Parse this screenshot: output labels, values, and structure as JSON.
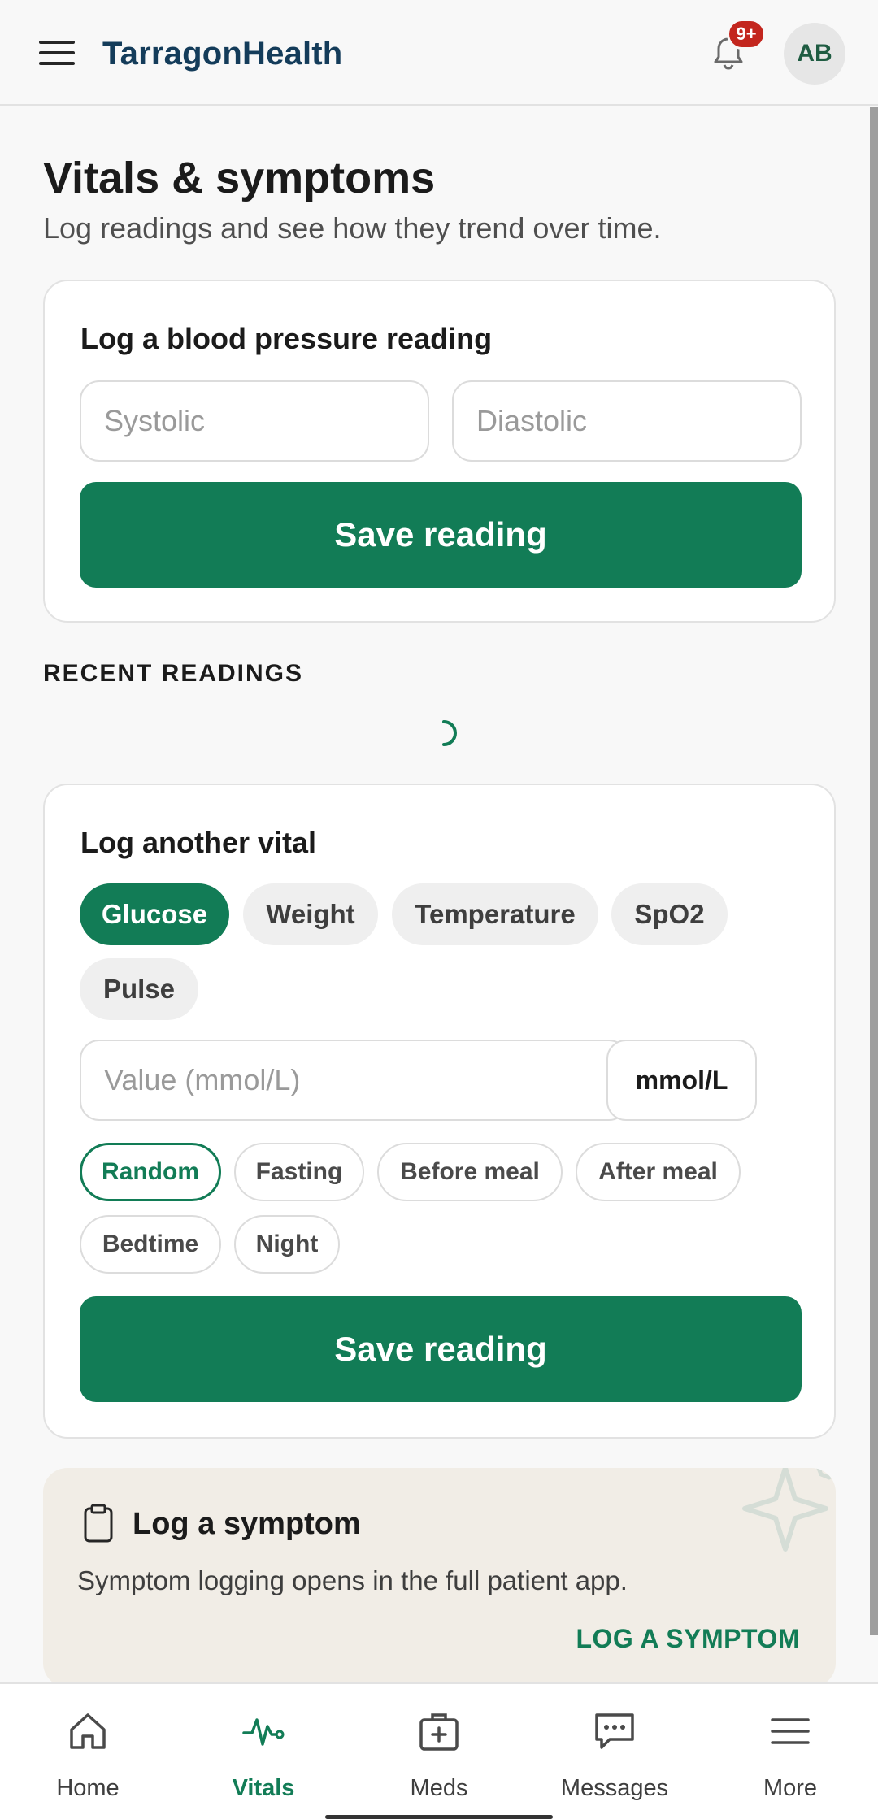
{
  "header": {
    "app_name": "TarragonHealth",
    "notification_badge": "9+",
    "avatar_initials": "AB"
  },
  "page": {
    "title": "Vitals & symptoms",
    "subtitle": "Log readings and see how they trend over time."
  },
  "bp_card": {
    "title": "Log a blood pressure reading",
    "systolic_placeholder": "Systolic",
    "diastolic_placeholder": "Diastolic",
    "save_label": "Save reading"
  },
  "recent": {
    "label": "RECENT READINGS"
  },
  "vital_card": {
    "title": "Log another vital",
    "vital_types": [
      "Glucose",
      "Weight",
      "Temperature",
      "SpO2",
      "Pulse"
    ],
    "selected_vital": "Glucose",
    "value_placeholder": "Value (mmol/L)",
    "unit": "mmol/L",
    "contexts": [
      "Random",
      "Fasting",
      "Before meal",
      "After meal",
      "Bedtime",
      "Night"
    ],
    "selected_context": "Random",
    "save_label": "Save reading"
  },
  "symptom_card": {
    "title": "Log a symptom",
    "text": "Symptom logging opens in the full patient app.",
    "link_label": "LOG A SYMPTOM"
  },
  "bottom_nav": {
    "items": [
      {
        "label": "Home",
        "icon": "home-icon"
      },
      {
        "label": "Vitals",
        "icon": "pulse-icon"
      },
      {
        "label": "Meds",
        "icon": "medkit-icon"
      },
      {
        "label": "Messages",
        "icon": "chat-icon"
      },
      {
        "label": "More",
        "icon": "menu-icon"
      }
    ],
    "active": "Vitals"
  },
  "colors": {
    "accent": "#127c56",
    "brand_text": "#143c5a",
    "badge": "#c3261e",
    "symptom_card_bg": "#f1ede6"
  }
}
